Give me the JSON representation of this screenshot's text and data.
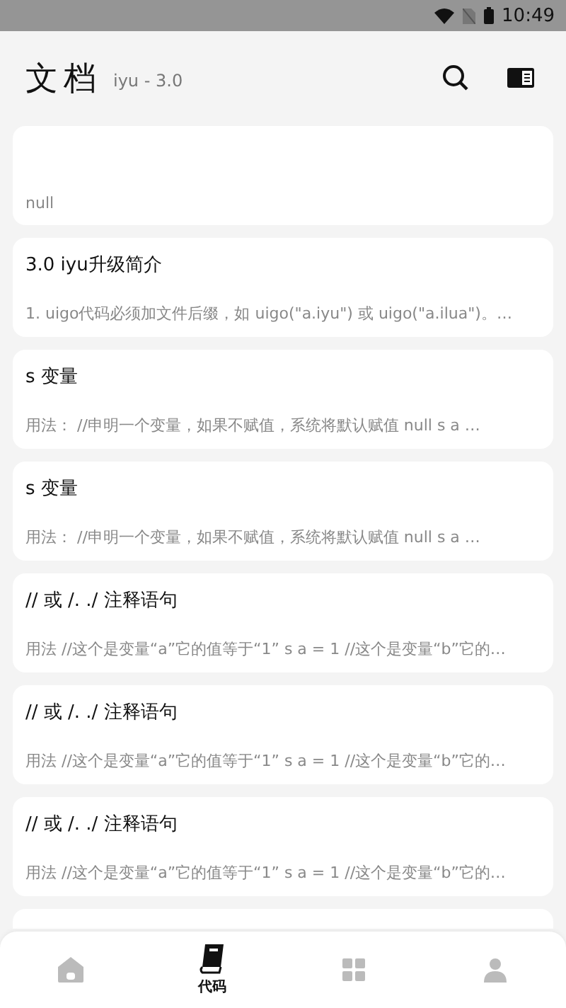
{
  "status_bar": {
    "time": "10:49"
  },
  "header": {
    "title": "文档",
    "subtitle": "iyu - 3.0"
  },
  "docs": [
    {
      "description": "null"
    },
    {
      "title": "3.0 iyu升级简介",
      "description": "1. uigo代码必须加文件后缀，如 uigo(\"a.iyu\") 或 uigo(\"a.ilua\")。…"
    },
    {
      "title": "s 变量",
      "description": "用法：  //申明一个变量，如果不赋值，系统将默认赋值 null s a  …"
    },
    {
      "title": "s 变量",
      "description": "用法：  //申明一个变量，如果不赋值，系统将默认赋值 null s a  …"
    },
    {
      "title": "// 或 /. ./ 注释语句",
      "description": "用法 //这个是变量“a”它的值等于“1” s a = 1 //这个是变量“b”它的…"
    },
    {
      "title": "// 或 /. ./ 注释语句",
      "description": "用法 //这个是变量“a”它的值等于“1” s a = 1 //这个是变量“b”它的…"
    },
    {
      "title": "// 或 /. ./ 注释语句",
      "description": "用法 //这个是变量“a”它的值等于“1” s a = 1 //这个是变量“b”它的…"
    }
  ],
  "more_below": true,
  "bottom_nav": [
    {
      "kind": "home",
      "selected": false
    },
    {
      "kind": "book",
      "label": "代码",
      "selected": true
    },
    {
      "kind": "tool",
      "selected": false
    },
    {
      "kind": "user",
      "selected": false
    }
  ]
}
